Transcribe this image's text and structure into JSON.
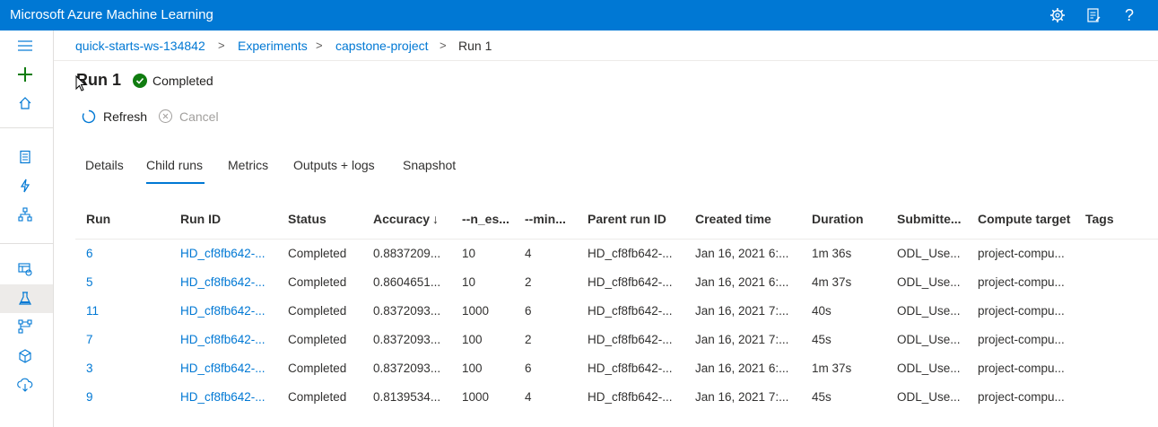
{
  "app": {
    "title": "Microsoft Azure Machine Learning"
  },
  "topbar": {
    "icons": [
      "gear-icon",
      "feedback-icon",
      "help-icon"
    ],
    "help_label": "?"
  },
  "leftnav": {
    "icons": [
      "hamburger-icon",
      "plus-icon",
      "home-icon",
      "notebook-icon",
      "automl-icon",
      "designer-icon",
      "datasets-icon",
      "experiments-icon",
      "pipelines-icon",
      "models-icon",
      "endpoints-icon"
    ]
  },
  "breadcrumb": {
    "items": [
      "quick-starts-ws-134842",
      "Experiments",
      "capstone-project",
      "Run 1"
    ],
    "separator": ">"
  },
  "run": {
    "title": "Run 1",
    "status": "Completed"
  },
  "commands": {
    "refresh": "Refresh",
    "cancel": "Cancel"
  },
  "tabs": [
    "Details",
    "Child runs",
    "Metrics",
    "Outputs + logs",
    "Snapshot"
  ],
  "active_tab": "Child runs",
  "table": {
    "columns": [
      "Run",
      "Run ID",
      "Status",
      "Accuracy",
      "--n_es...",
      "--min...",
      "Parent run ID",
      "Created time",
      "Duration",
      "Submitte...",
      "Compute target",
      "Tags"
    ],
    "sort_indicator": "↓",
    "rows": [
      [
        "6",
        "HD_cf8fb642-...",
        "Completed",
        "0.8837209...",
        "10",
        "4",
        "HD_cf8fb642-...",
        "Jan 16, 2021 6:...",
        "1m 36s",
        "ODL_Use...",
        "project-compu...",
        ""
      ],
      [
        "5",
        "HD_cf8fb642-...",
        "Completed",
        "0.8604651...",
        "10",
        "2",
        "HD_cf8fb642-...",
        "Jan 16, 2021 6:...",
        "4m 37s",
        "ODL_Use...",
        "project-compu...",
        ""
      ],
      [
        "11",
        "HD_cf8fb642-...",
        "Completed",
        "0.8372093...",
        "1000",
        "6",
        "HD_cf8fb642-...",
        "Jan 16, 2021 7:...",
        "40s",
        "ODL_Use...",
        "project-compu...",
        ""
      ],
      [
        "7",
        "HD_cf8fb642-...",
        "Completed",
        "0.8372093...",
        "100",
        "2",
        "HD_cf8fb642-...",
        "Jan 16, 2021 7:...",
        "45s",
        "ODL_Use...",
        "project-compu...",
        ""
      ],
      [
        "3",
        "HD_cf8fb642-...",
        "Completed",
        "0.8372093...",
        "100",
        "6",
        "HD_cf8fb642-...",
        "Jan 16, 2021 6:...",
        "1m 37s",
        "ODL_Use...",
        "project-compu...",
        ""
      ],
      [
        "9",
        "HD_cf8fb642-...",
        "Completed",
        "0.8139534...",
        "1000",
        "4",
        "HD_cf8fb642-...",
        "Jan 16, 2021 7:...",
        "45s",
        "ODL_Use...",
        "project-compu...",
        ""
      ]
    ]
  },
  "colors": {
    "brand": "#0078d4",
    "success": "#107c10",
    "nav_icon": "#0078d4",
    "plus_icon": "#107c10"
  }
}
